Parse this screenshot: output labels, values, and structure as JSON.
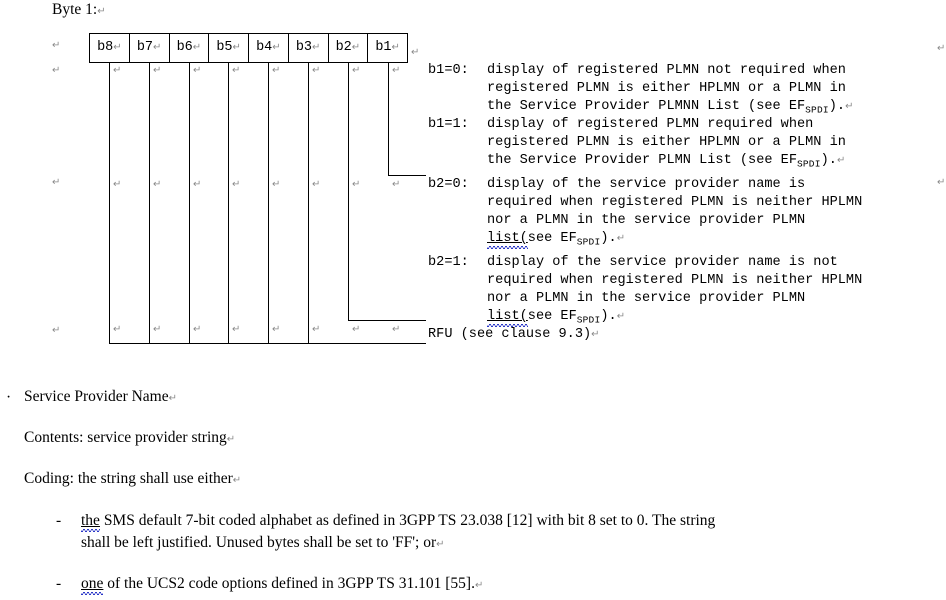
{
  "document": {
    "byte_heading": "Byte 1:",
    "return_mark": "↵"
  },
  "bit_table": {
    "cells": [
      {
        "label": "b8"
      },
      {
        "label": "b7"
      },
      {
        "label": "b6"
      },
      {
        "label": "b5"
      },
      {
        "label": "b4"
      },
      {
        "label": "b3"
      },
      {
        "label": "b2"
      },
      {
        "label": "b1"
      }
    ]
  },
  "descriptions": {
    "b1_0": {
      "tag": "b1=0:",
      "line1": "display of registered PLMN not required when",
      "line2": "registered PLMN is either HPLMN or a PLMN in",
      "line3_pre": "the Service Provider PLMNN List (see EF",
      "line3_sub": "SPDI",
      "line3_post": ")."
    },
    "b1_1": {
      "tag": "b1=1:",
      "line1": "display of registered PLMN required when",
      "line2": "registered PLMN is either HPLMN or a PLMN in",
      "line3_pre": "the Service Provider PLMN List (see EF",
      "line3_sub": "SPDI",
      "line3_post": ")."
    },
    "b2_0": {
      "tag": "b2=0:",
      "line1": "display of the service provider name is",
      "line2": "required when registered PLMN is neither HPLMN",
      "line3": "nor a PLMN in the service provider PLMN",
      "line4_word": "list(",
      "line4_pre": "see EF",
      "line4_sub": "SPDI",
      "line4_post": ")."
    },
    "b2_1": {
      "tag": "b2=1:",
      "line1": "display of the service provider name is not",
      "line2": "required when registered PLMN is neither HPLMN",
      "line3": "nor a PLMN in the service provider PLMN",
      "line4_word": "list(",
      "line4_pre": "see EF",
      "line4_sub": "SPDI",
      "line4_post": ")."
    },
    "rfu": {
      "text": "RFU (see clause 9.3)"
    }
  },
  "body": {
    "bullet_marker": "·",
    "dash_marker": "-",
    "item_title": "Service Provider Name",
    "contents_line": "Contents: service provider string",
    "coding_line": "Coding: the string shall use either",
    "bullet1_word": "the",
    "bullet1_rest": " SMS default 7-bit coded alphabet as defined in 3GPP TS 23.038 [12] with bit 8 set to 0. The string",
    "bullet1_line2": "shall be left justified. Unused bytes shall be set to 'FF'; or",
    "bullet2_word": "one",
    "bullet2_rest": " of the UCS2 code options defined in 3GPP TS 31.101 [55]."
  }
}
